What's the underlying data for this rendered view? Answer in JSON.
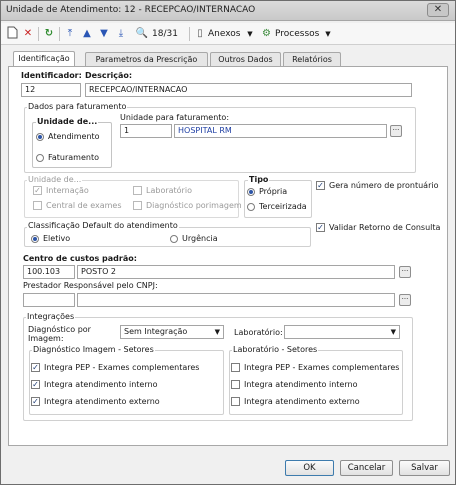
{
  "window": {
    "title": "Unidade de Atendimento: 12 - RECEPCAO/INTERNACAO"
  },
  "toolbar": {
    "record_counter": "18/31",
    "anexos_label": "Anexos",
    "processos_label": "Processos"
  },
  "tabs": [
    {
      "label": "Identificação"
    },
    {
      "label": "Parametros da Prescrição"
    },
    {
      "label": "Outros Dados"
    },
    {
      "label": "Relatórios"
    }
  ],
  "identification": {
    "id_label": "Identificador:",
    "id_value": "12",
    "desc_label": "Descrição:",
    "desc_value": "RECEPCAO/INTERNACAO"
  },
  "billing": {
    "group_title": "Dados para faturamento",
    "unit_group_title": "Unidade de...",
    "radio_atendimento": "Atendimento",
    "radio_faturamento": "Faturamento",
    "unit_label": "Unidade para faturamento:",
    "unit_code": "1",
    "unit_name": "HOSPITAL RM"
  },
  "unit_type": {
    "group_title": "Unidade de...",
    "internacao": "Internação",
    "laboratorio": "Laboratório",
    "central_exames": "Central de exames",
    "diagnostico_imagem": "Diagnóstico porimagem"
  },
  "tipo": {
    "title": "Tipo",
    "propria": "Própria",
    "terceirizada": "Terceirizada"
  },
  "gera_prontuario": "Gera número de prontuário",
  "validar_retorno": "Validar Retorno de Consulta",
  "classificacao": {
    "group_title": "Classificação Default do atendimento",
    "eletivo": "Eletivo",
    "urgencia": "Urgência"
  },
  "custos": {
    "label": "Centro de custos padrão:",
    "code": "100.103",
    "name": "POSTO 2"
  },
  "prestador": {
    "label": "Prestador Responsável pelo CNPJ:"
  },
  "integracoes": {
    "group_title": "Integrações",
    "diagnostico_label": "Diagnóstico por Imagem:",
    "diagnostico_value": "Sem Integração",
    "laboratorio_label": "Laboratório:",
    "laboratorio_value": ""
  },
  "diag_setores": {
    "title": "Diagnóstico Imagem - Setores",
    "items": [
      {
        "label": "Integra PEP - Exames complementares",
        "checked": true
      },
      {
        "label": "Integra atendimento interno",
        "checked": true
      },
      {
        "label": "Integra atendimento externo",
        "checked": true
      }
    ]
  },
  "lab_setores": {
    "title": "Laboratório - Setores",
    "items": [
      {
        "label": "Integra PEP - Exames complementares",
        "checked": false
      },
      {
        "label": "Integra atendimento interno",
        "checked": false
      },
      {
        "label": "Integra atendimento externo",
        "checked": false
      }
    ]
  },
  "buttons": {
    "ok": "OK",
    "cancel": "Cancelar",
    "save": "Salvar"
  },
  "icons": {
    "new": "new-document-icon",
    "delete": "delete-icon",
    "refresh": "refresh-icon",
    "first": "first-record-icon",
    "prev": "previous-record-icon",
    "next": "next-record-icon",
    "last": "last-record-icon",
    "search": "binoculars-icon",
    "attach": "attachment-icon",
    "processes": "processes-icon"
  }
}
